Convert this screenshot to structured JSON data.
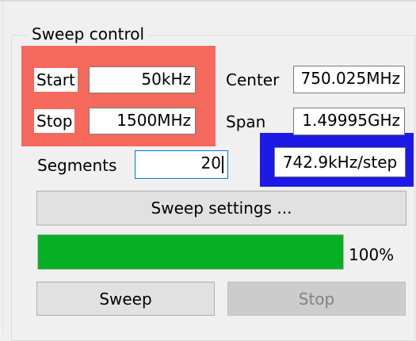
{
  "group": {
    "title": "Sweep control"
  },
  "fields": {
    "start": {
      "label": "Start",
      "value": "50kHz"
    },
    "stop": {
      "label": "Stop",
      "value": "1500MHz"
    },
    "center": {
      "label": "Center",
      "value": "750.025MHz"
    },
    "span": {
      "label": "Span",
      "value": "1.49995GHz"
    },
    "segments": {
      "label": "Segments",
      "value": "20"
    }
  },
  "step_readout": "742.9kHz/step",
  "buttons": {
    "settings": "Sweep settings ...",
    "sweep": "Sweep",
    "stop": "Stop"
  },
  "progress": {
    "value": 1.0,
    "label": "100%"
  },
  "colors": {
    "highlight_red": "#f4695c",
    "highlight_blue": "#1d1ae6",
    "progress_green": "#06b025"
  }
}
